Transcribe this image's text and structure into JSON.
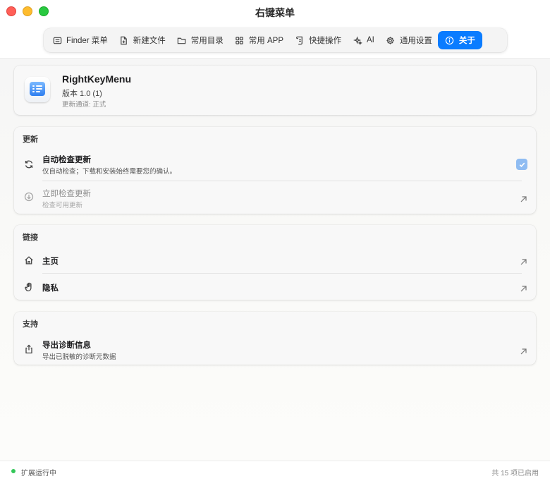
{
  "window": {
    "title": "右键菜单"
  },
  "tabs": [
    {
      "label": "Finder 菜单",
      "icon": "finder-menu-icon"
    },
    {
      "label": "新建文件",
      "icon": "new-file-icon"
    },
    {
      "label": "常用目录",
      "icon": "folder-icon"
    },
    {
      "label": "常用 APP",
      "icon": "grid-apps-icon"
    },
    {
      "label": "快捷操作",
      "icon": "scroll-icon"
    },
    {
      "label": "AI",
      "icon": "sparkle-icon"
    },
    {
      "label": "通用设置",
      "icon": "gear-icon"
    },
    {
      "label": "关于",
      "icon": "info-icon",
      "active": true
    }
  ],
  "app": {
    "name": "RightKeyMenu",
    "version": "版本 1.0 (1)",
    "channel": "更新通道: 正式"
  },
  "updates": {
    "title": "更新",
    "auto_check": {
      "title": "自动检查更新",
      "subtitle": "仅自动检查；下载和安装始终需要您的确认。",
      "checked": true
    },
    "check_now": {
      "title": "立即检查更新",
      "subtitle": "检查可用更新",
      "disabled": true
    }
  },
  "links": {
    "title": "链接",
    "homepage": "主页",
    "privacy": "隐私"
  },
  "support": {
    "title": "支持",
    "export": {
      "title": "导出诊断信息",
      "subtitle": "导出已脱敏的诊断元数据"
    }
  },
  "status": {
    "left": "扩展运行中",
    "right": "共 15 项已启用",
    "dot_color": "#34c759"
  },
  "colors": {
    "accent": "#0a7cff",
    "close": "#ff5f57",
    "minimize": "#febc2e",
    "maximize": "#28c840"
  }
}
